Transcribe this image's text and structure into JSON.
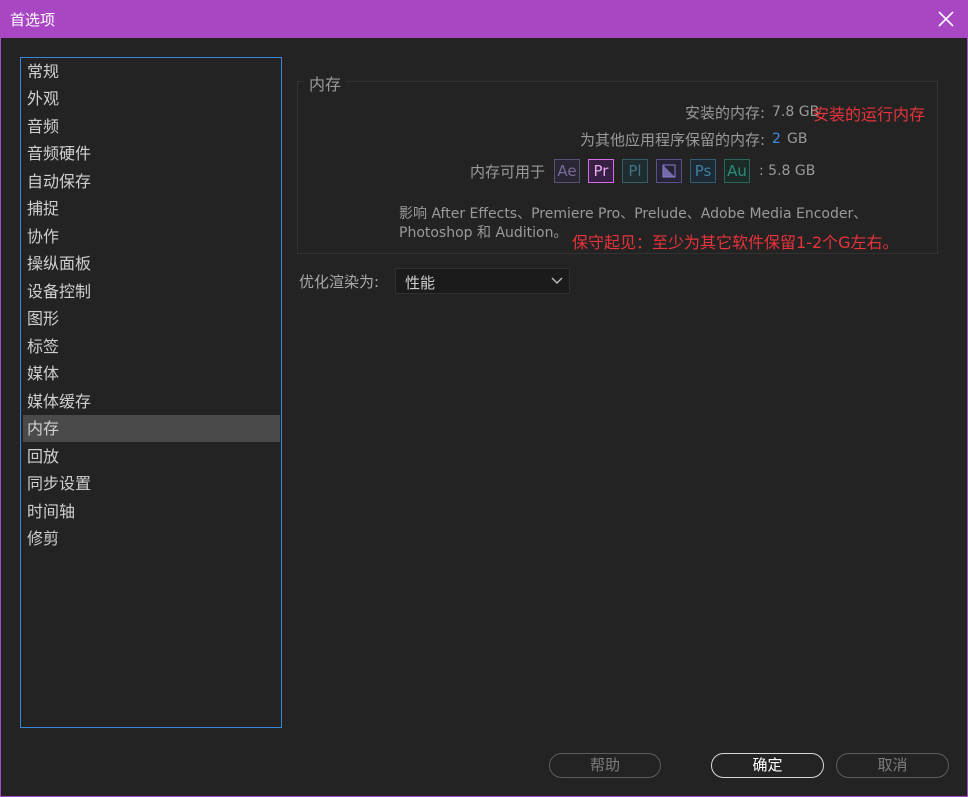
{
  "window": {
    "title": "首选项"
  },
  "sidebar": {
    "items": [
      {
        "label": "常规"
      },
      {
        "label": "外观"
      },
      {
        "label": "音频"
      },
      {
        "label": "音频硬件"
      },
      {
        "label": "自动保存"
      },
      {
        "label": "捕捉"
      },
      {
        "label": "协作"
      },
      {
        "label": "操纵面板"
      },
      {
        "label": "设备控制"
      },
      {
        "label": "图形"
      },
      {
        "label": "标签"
      },
      {
        "label": "媒体"
      },
      {
        "label": "媒体缓存"
      },
      {
        "label": "内存",
        "active": true
      },
      {
        "label": "回放"
      },
      {
        "label": "同步设置"
      },
      {
        "label": "时间轴"
      },
      {
        "label": "修剪"
      }
    ]
  },
  "memory": {
    "group_title": "内存",
    "installed_label": "安装的内存:",
    "installed_value": "7.8 GB",
    "installed_annotation": "安装的运行内存",
    "reserved_label": "为其他应用程序保留的内存:",
    "reserved_value": "2",
    "reserved_unit": "GB",
    "available_label": "内存可用于",
    "available_value": ": 5.8 GB",
    "apps": [
      {
        "name": "Ae",
        "color": "#7a6a9a",
        "border": "#5a4f74",
        "bg": "#2a2633"
      },
      {
        "name": "Pr",
        "color": "#e6a9f2",
        "border": "#d36ee8",
        "bg": "#3a1f44"
      },
      {
        "name": "Pl",
        "color": "#3f7683",
        "border": "#355d67",
        "bg": "#1f2c30"
      },
      {
        "name": "",
        "color": "#8a7dc9",
        "border": "#5a4f8a",
        "bg": "#262336"
      },
      {
        "name": "Ps",
        "color": "#3f7ea0",
        "border": "#335d74",
        "bg": "#1d2a33"
      },
      {
        "name": "Au",
        "color": "#2f8a7a",
        "border": "#2c6559",
        "bg": "#1b2c28"
      }
    ],
    "note_line1": "影响 After Effects、Premiere Pro、Prelude、Adobe Media Encoder、",
    "note_line2": "Photoshop 和 Audition。",
    "note_annotation": "保守起见：至少为其它软件保留1-2个G左右。"
  },
  "optimize": {
    "label": "优化渲染为:",
    "value": "性能"
  },
  "buttons": {
    "help": "帮助",
    "ok": "确定",
    "cancel": "取消"
  },
  "colors": {
    "titlebar": "#a846c4",
    "sidebar_border": "#3a86d4",
    "annotation": "#e8333a",
    "link_blue": "#3b8fe0"
  }
}
